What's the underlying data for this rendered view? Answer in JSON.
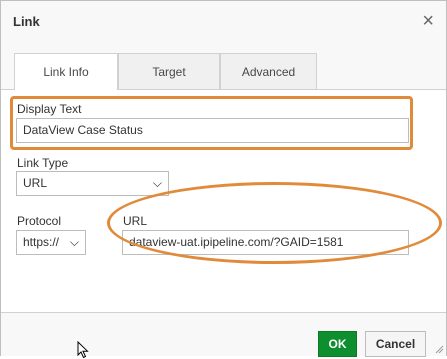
{
  "dialog": {
    "title": "Link",
    "close_glyph": "×"
  },
  "tabs": [
    {
      "label": "Link Info",
      "active": true
    },
    {
      "label": "Target",
      "active": false
    },
    {
      "label": "Advanced",
      "active": false
    }
  ],
  "form": {
    "display_text_label": "Display Text",
    "display_text_value": "DataView Case Status",
    "link_type_label": "Link Type",
    "link_type_value": "URL",
    "protocol_label": "Protocol",
    "protocol_value": "https://",
    "url_label": "URL",
    "url_value": "dataview-uat.ipipeline.com/?GAID=1581"
  },
  "footer": {
    "ok_label": "OK",
    "cancel_label": "Cancel"
  },
  "annotation_color": "#e08a3a",
  "icons": [
    "close-icon",
    "chevron-down-icon",
    "mouse-cursor-icon",
    "resize-grip-icon"
  ]
}
